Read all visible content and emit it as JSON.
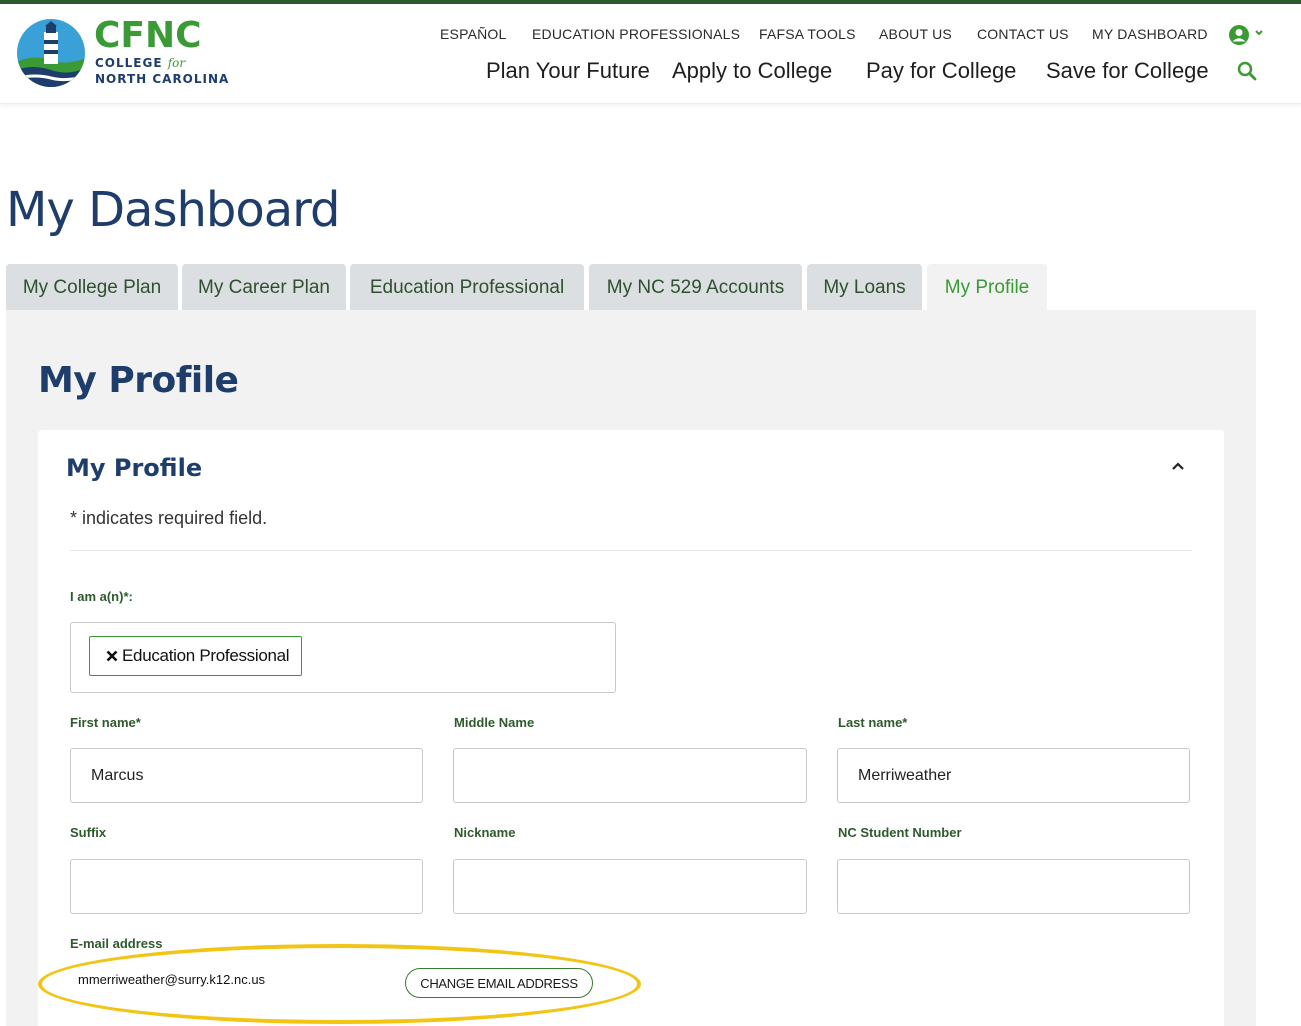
{
  "brand": {
    "main": "CFNC",
    "line1": "COLLEGE",
    "line1_for": "for",
    "line2": "NORTH CAROLINA",
    "green": "#3a9a35",
    "navy": "#1f3d6b"
  },
  "utility_nav": [
    "ESPAÑOL",
    "EDUCATION PROFESSIONALS",
    "FAFSA TOOLS",
    "ABOUT US",
    "CONTACT US",
    "MY DASHBOARD"
  ],
  "main_nav": [
    "Plan Your Future",
    "Apply to College",
    "Pay for College",
    "Save for College"
  ],
  "icons": {
    "account": "user-circle-icon",
    "dropdown": "chevron-down-icon",
    "search": "search-icon",
    "collapse": "chevron-up-icon",
    "remove": "close-icon"
  },
  "page_title": "My Dashboard",
  "tabs": [
    "My College Plan",
    "My Career Plan",
    "Education Professional",
    "My NC 529 Accounts",
    "My Loans",
    "My Profile"
  ],
  "active_tab": "My Profile",
  "panel_title": "My Profile",
  "card": {
    "title": "My Profile",
    "required_note": "* indicates required field."
  },
  "form": {
    "role_label": "I am a(n)*:",
    "role_chip": "Education Professional",
    "first_name_label": "First name*",
    "first_name_value": "Marcus",
    "middle_name_label": "Middle Name",
    "middle_name_value": "",
    "last_name_label": "Last name*",
    "last_name_value": "Merriweather",
    "suffix_label": "Suffix",
    "suffix_value": "",
    "nickname_label": "Nickname",
    "nickname_value": "",
    "student_number_label": "NC Student Number",
    "student_number_value": "",
    "email_label": "E-mail address",
    "email_value": "mmerriweather@surry.k12.nc.us",
    "change_email_button": "CHANGE EMAIL ADDRESS"
  },
  "annotation_color": "#f2c414"
}
